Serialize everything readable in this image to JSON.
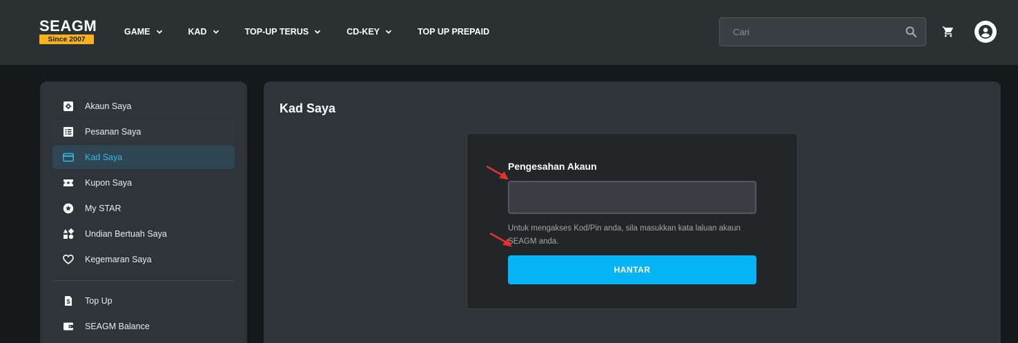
{
  "brand": {
    "name": "SEAGM",
    "badge": "Since 2007",
    "badge_color": "#f7b21d"
  },
  "nav": {
    "items": [
      {
        "label": "GAME",
        "has_dropdown": true
      },
      {
        "label": "KAD",
        "has_dropdown": true
      },
      {
        "label": "TOP-UP TERUS",
        "has_dropdown": true
      },
      {
        "label": "CD-KEY",
        "has_dropdown": true
      },
      {
        "label": "TOP UP PREPAID",
        "has_dropdown": false
      }
    ]
  },
  "search": {
    "placeholder": "Cari",
    "icon": "search-icon"
  },
  "header_icons": {
    "cart": "cart-icon",
    "account": "account-circle-icon"
  },
  "sidebar": {
    "items": [
      {
        "label": "Akaun Saya",
        "icon": "account-settings-icon",
        "state": "normal"
      },
      {
        "label": "Pesanan Saya",
        "icon": "orders-list-icon",
        "state": "hover"
      },
      {
        "label": "Kad Saya",
        "icon": "credit-card-icon",
        "state": "active"
      },
      {
        "label": "Kupon Saya",
        "icon": "coupon-icon",
        "state": "normal"
      },
      {
        "label": "My STAR",
        "icon": "star-circle-icon",
        "state": "normal"
      },
      {
        "label": "Undian Bertuah Saya",
        "icon": "shapes-icon",
        "state": "normal"
      },
      {
        "label": "Kegemaran Saya",
        "icon": "heart-icon",
        "state": "normal"
      }
    ],
    "secondary_items": [
      {
        "label": "Top Up",
        "icon": "dollar-document-icon"
      },
      {
        "label": "SEAGM Balance",
        "icon": "wallet-icon"
      }
    ]
  },
  "main": {
    "title": "Kad Saya",
    "form": {
      "label": "Pengesahan Akaun",
      "input_value": "",
      "help_text": "Untuk mengakses Kod/Pin anda, sila masukkan kata laluan akaun SEAGM anda.",
      "submit_label": "HANTAR"
    }
  },
  "colors": {
    "accent": "#06b3f5",
    "active_text": "#3bb5ec",
    "annotation_arrow": "#e8302f",
    "header_bg": "#2b3033",
    "panel_bg": "#2e3438"
  }
}
